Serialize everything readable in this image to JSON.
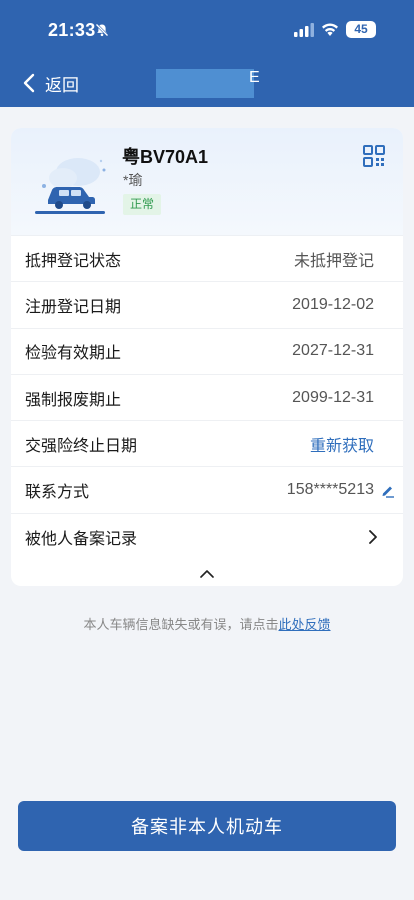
{
  "status_bar": {
    "time": "21:33",
    "battery": "45"
  },
  "nav": {
    "back_label": "返回",
    "title_tail": "E"
  },
  "vehicle": {
    "plate": "粤BV70A1",
    "owner": "*瑜",
    "status_badge": "正常"
  },
  "rows": [
    {
      "label": "抵押登记状态",
      "value": "未抵押登记"
    },
    {
      "label": "注册登记日期",
      "value": "2019-12-02"
    },
    {
      "label": "检验有效期止",
      "value": "2027-12-31"
    },
    {
      "label": "强制报废期止",
      "value": "2099-12-31"
    },
    {
      "label": "交强险终止日期",
      "value": "重新获取"
    },
    {
      "label": "联系方式",
      "value": "158****5213"
    },
    {
      "label": "被他人备案记录",
      "value": ""
    }
  ],
  "feedback": {
    "text": "本人车辆信息缺失或有误，请点击",
    "link": "此处反馈"
  },
  "cta_label": "备案非本人机动车",
  "colors": {
    "primary": "#2f64b0",
    "link": "#2f6ebc",
    "badge_bg": "#e3f4e7",
    "badge_text": "#2f9a4e"
  },
  "icons": [
    "mute-icon",
    "signal-icon",
    "wifi-icon",
    "battery-icon",
    "back-icon",
    "car-illustration",
    "qr-code-icon",
    "edit-icon",
    "chevron-right-icon",
    "chevron-up-icon"
  ]
}
